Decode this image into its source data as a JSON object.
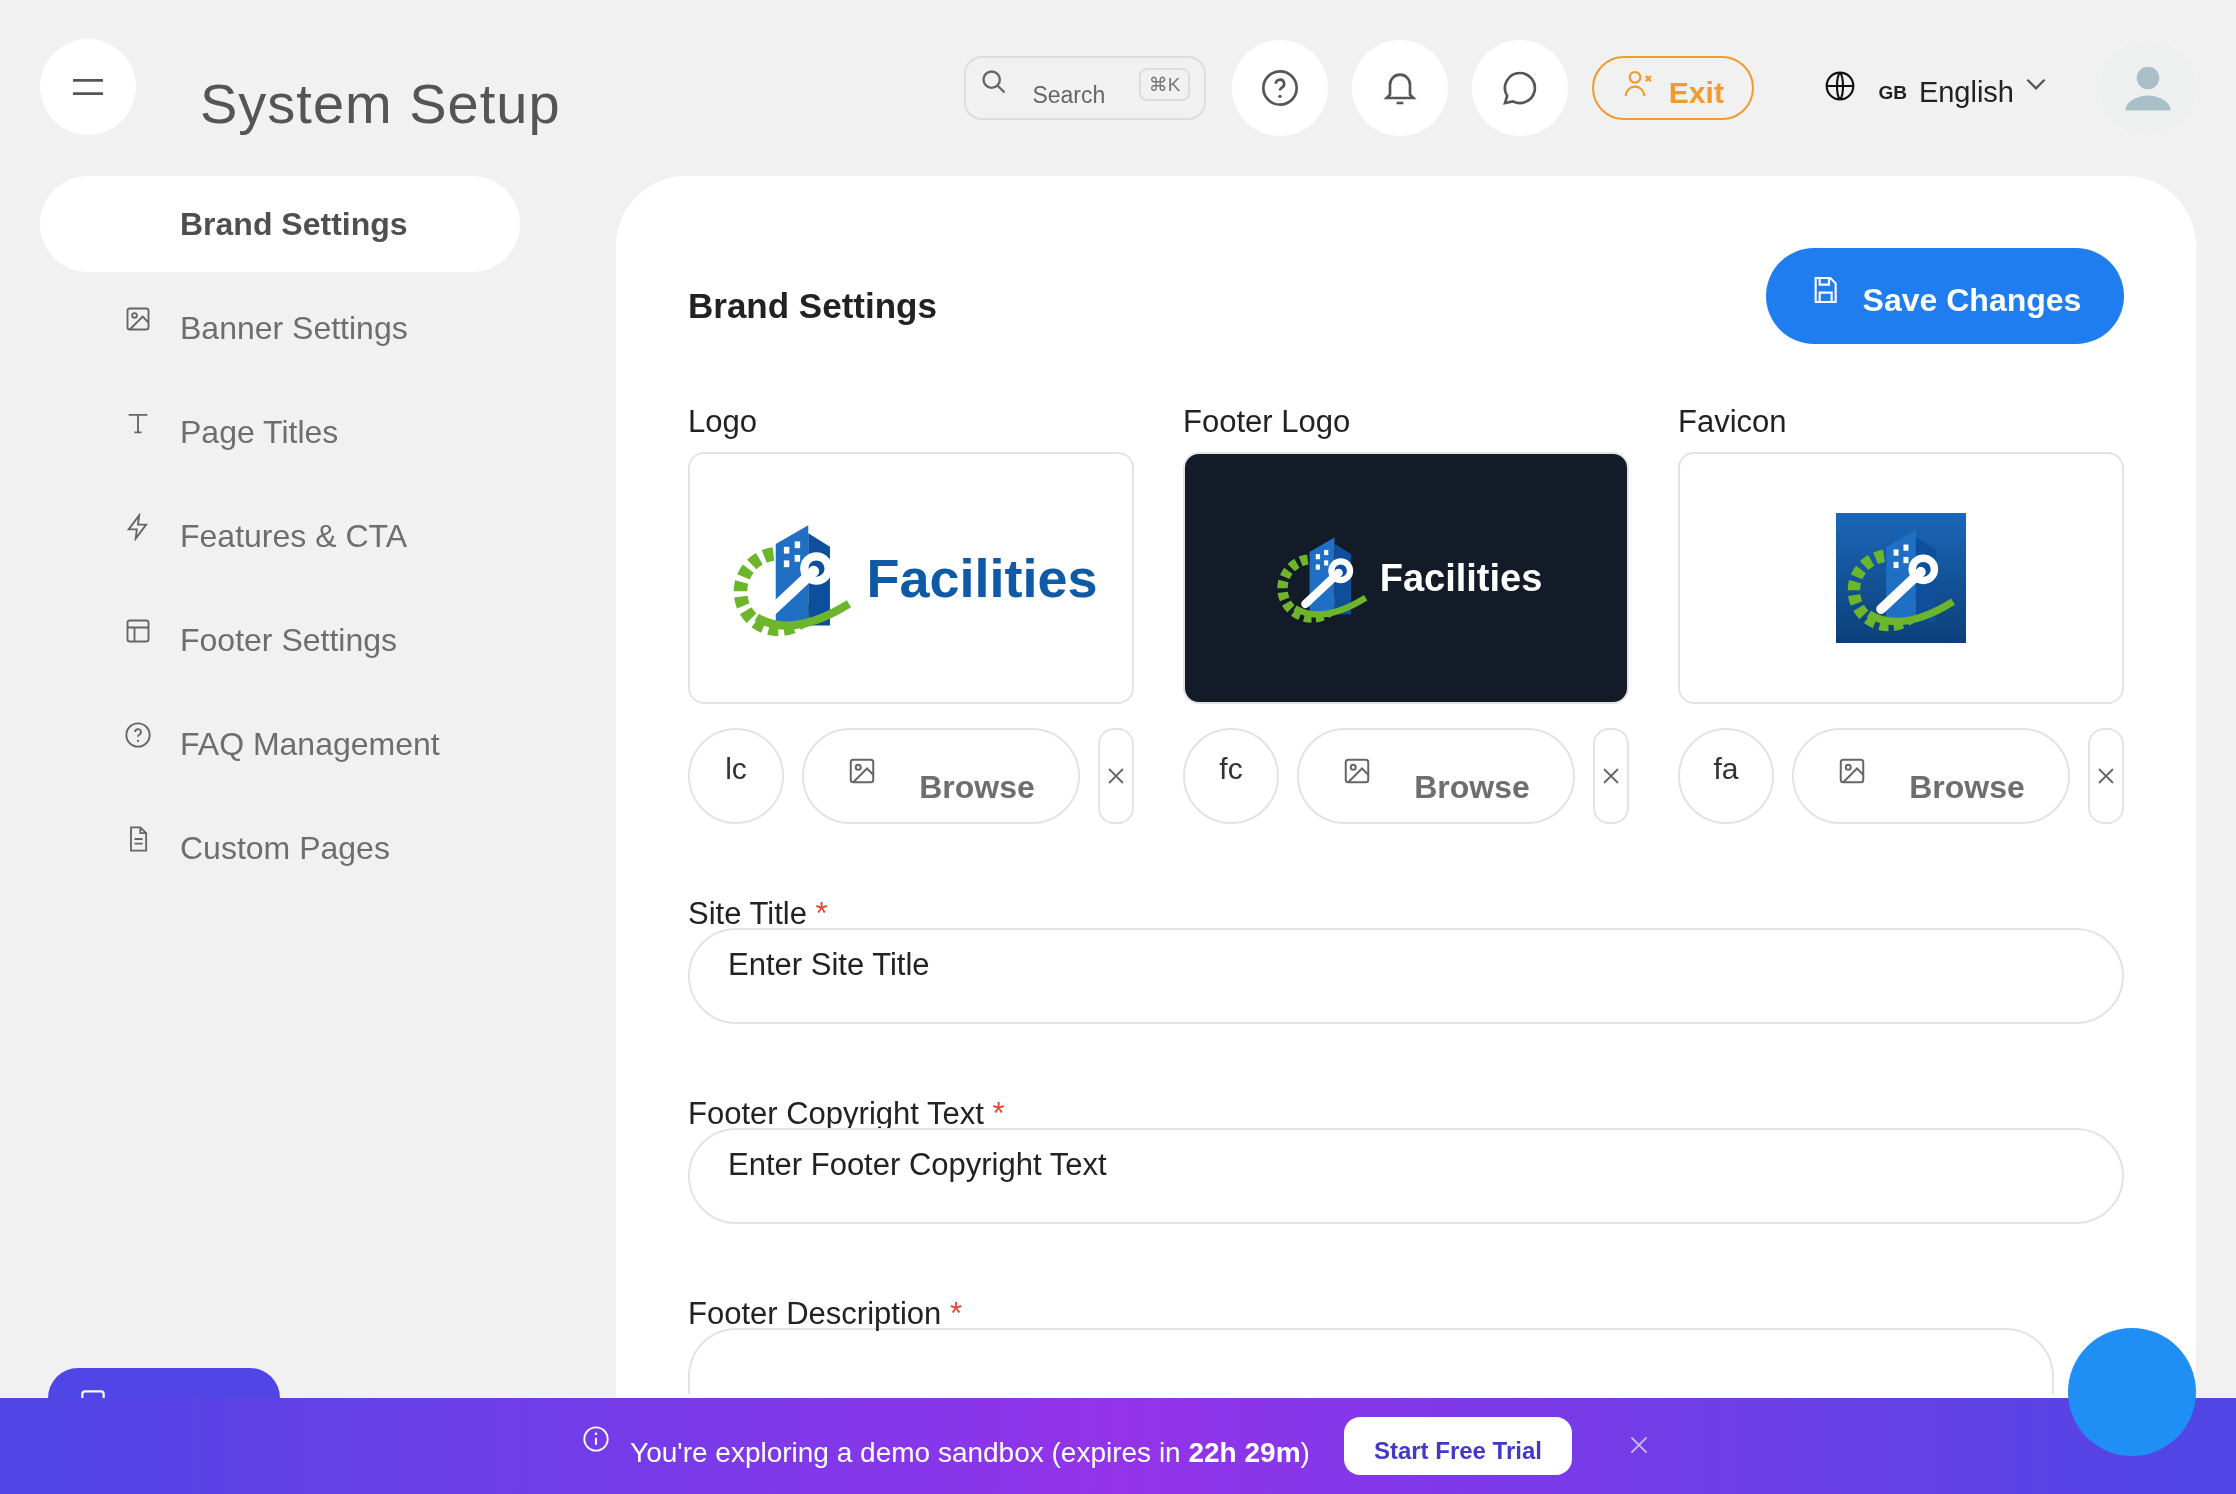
{
  "header": {
    "title": "System Setup",
    "search": {
      "placeholder": "Search",
      "shortcut": "⌘K"
    },
    "exit_label": "Exit",
    "language": {
      "region": "GB",
      "label": "English"
    }
  },
  "sidebar": {
    "items": [
      {
        "label": "Brand Settings",
        "selected": true
      },
      {
        "label": "Banner Settings",
        "selected": false
      },
      {
        "label": "Page Titles",
        "selected": false
      },
      {
        "label": "Features & CTA",
        "selected": false
      },
      {
        "label": "Footer Settings",
        "selected": false
      },
      {
        "label": "FAQ Management",
        "selected": false
      },
      {
        "label": "Custom Pages",
        "selected": false
      }
    ]
  },
  "panel": {
    "title": "Brand Settings",
    "save_label": "Save Changes",
    "uploads": [
      {
        "label": "Logo",
        "kind": "wordmark",
        "dark": false,
        "brand_text": "Facilities",
        "file_name": "lc",
        "browse_label": "Browse"
      },
      {
        "label": "Footer Logo",
        "kind": "wordmark",
        "dark": true,
        "brand_text": "Facilities",
        "file_name": "fc",
        "browse_label": "Browse"
      },
      {
        "label": "Favicon",
        "kind": "emblem",
        "dark": false,
        "file_name": "fa",
        "browse_label": "Browse"
      }
    ],
    "fields": [
      {
        "label": "Site Title",
        "marker": "*",
        "kind": "input",
        "placeholder": "Enter Site Title"
      },
      {
        "label": "Footer Copyright Text",
        "marker": "*",
        "kind": "input",
        "placeholder": "Enter Footer Copyright Text"
      },
      {
        "label": "Footer Description",
        "marker": "*",
        "kind": "textarea"
      }
    ]
  },
  "banner": {
    "message": "You're exploring a demo sandbox (expires in **22h  29m**)",
    "button": "Start Free Trial"
  }
}
